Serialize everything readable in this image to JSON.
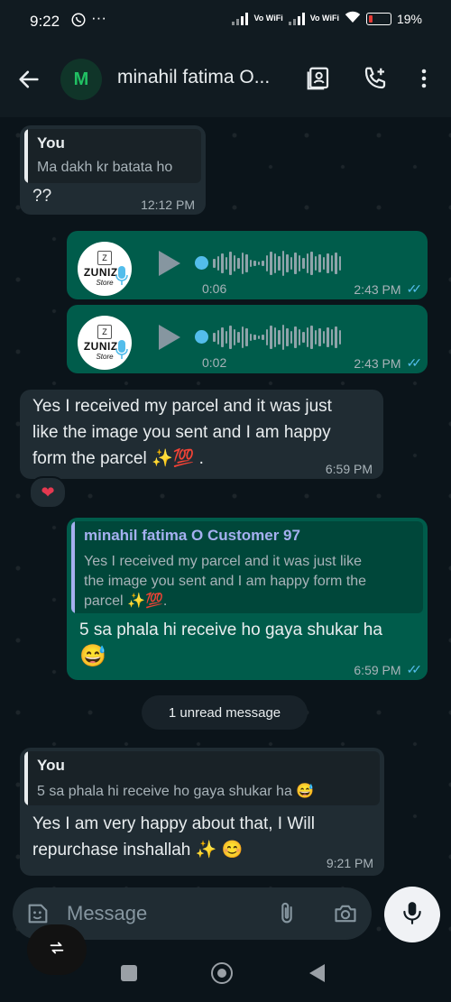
{
  "status_bar": {
    "time": "9:22",
    "network_1": "Vo WiFi",
    "network_2": "Vo WiFi",
    "battery": "19%"
  },
  "header": {
    "avatar_letter": "M",
    "title": "minahil fatima O..."
  },
  "messages": {
    "m1": {
      "quote_name": "You",
      "quote_text": "Ma dakh kr batata ho",
      "text": "??",
      "time": "12:12 PM"
    },
    "v1": {
      "brand": "ZUNIZE",
      "brand_sub": "Store",
      "bag_letter": "Z",
      "duration": "0:06",
      "time": "2:43 PM"
    },
    "v2": {
      "brand": "ZUNIZE",
      "brand_sub": "Store",
      "bag_letter": "Z",
      "duration": "0:02",
      "time": "2:43 PM"
    },
    "m2": {
      "line1": "Yes I received my parcel and it was just",
      "line2": "like the image you sent and I am happy",
      "line3": "form the parcel ✨💯 .",
      "time": "6:59 PM",
      "reaction": "❤"
    },
    "m3": {
      "quote_name": "minahil fatima O Customer 97",
      "quote_line1": "Yes I received my parcel and it was just like",
      "quote_line2": "the image you sent and I am happy form the",
      "quote_line3": "parcel ✨💯.",
      "line1": "5 sa phala hi receive ho gaya shukar ha",
      "line2": "😅",
      "time": "6:59 PM"
    },
    "m4": {
      "quote_name": "You",
      "quote_text": "5 sa phala hi receive ho gaya shukar ha 😅",
      "line1": "Yes I am very happy about that, I Will",
      "line2": "repurchase inshallah ✨ 😊",
      "time": "9:21 PM"
    }
  },
  "unread_banner": "1 unread message",
  "input": {
    "placeholder": "Message"
  },
  "colors": {
    "incoming": "#202c33",
    "outgoing": "#005c4b",
    "tick_read": "#53bdeb",
    "brand_green": "#21c063"
  }
}
